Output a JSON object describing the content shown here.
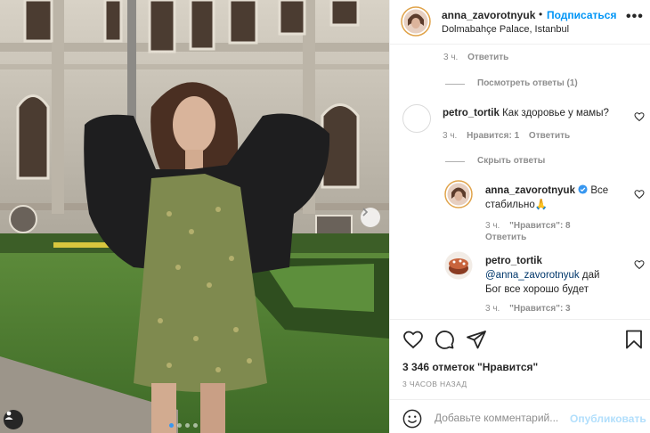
{
  "post": {
    "username": "anna_zavorotnyuk",
    "separator": "•",
    "follow_label": "Подписаться",
    "location": "Dolmabahçe Palace, Istanbul",
    "more_label": "•••"
  },
  "comments": {
    "top_time": "3 ч.",
    "top_reply": "Ответить",
    "view_replies": "Посмотреть ответы (1)",
    "main": {
      "username": "petro_tortik",
      "text": "Как здоровье у мамы?",
      "time": "3 ч.",
      "likes": "Нравится: 1",
      "reply": "Ответить"
    },
    "hide_replies": "Скрыть ответы",
    "replies": [
      {
        "username": "anna_zavorotnyuk",
        "text_line1": "Все",
        "text_line2": "стабильно🙏",
        "time": "3 ч.",
        "likes": "\"Нравится\": 8",
        "reply": "Ответить"
      },
      {
        "username": "petro_tortik",
        "mention": "@anna_zavorotnyuk",
        "text_tail": "дай",
        "text_line3": "Бог все хорошо будет",
        "time": "3 ч.",
        "likes": "\"Нравится\": 3"
      }
    ]
  },
  "actions": {
    "likes_count": "3 346 отметок \"Нравится\"",
    "time_ago": "3 ЧАСОВ НАЗАД"
  },
  "add_comment": {
    "placeholder": "Добавьте комментарий...",
    "post_label": "Опубликовать"
  },
  "icons": [
    "next-arrow-icon",
    "tag-user-icon",
    "verified-icon",
    "heart-icon",
    "comment-icon",
    "share-icon",
    "bookmark-icon",
    "emoji-icon"
  ],
  "colors": {
    "accent": "#0095f6",
    "verified": "#3897f0",
    "muted": "#8e8e8e",
    "text": "#262626"
  }
}
